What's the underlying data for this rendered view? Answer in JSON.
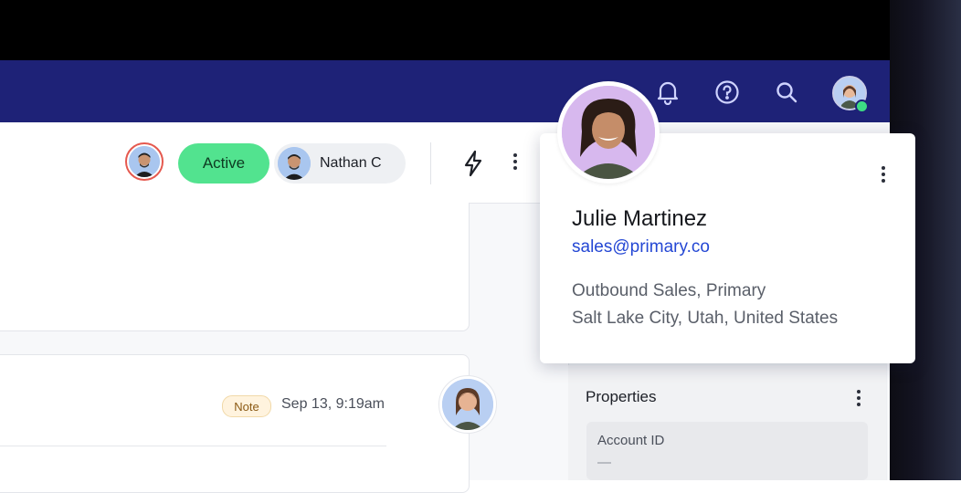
{
  "header": {
    "icons": [
      "bell-icon",
      "help-icon",
      "search-icon",
      "user-avatar"
    ]
  },
  "record": {
    "status_label": "Active",
    "owner_name": "Nathan C"
  },
  "timeline": {
    "note_badge": "Note",
    "note_time": "Sep 13, 9:19am"
  },
  "sidebar": {
    "properties_title": "Properties",
    "account_id_label": "Account ID",
    "account_id_value": "—"
  },
  "contact_popup": {
    "name": "Julie Martinez",
    "email": "sales@primary.co",
    "company": "Outbound Sales, Primary",
    "location": "Salt Lake City, Utah, United States"
  },
  "colors": {
    "navbar": "#1e2277",
    "active_status": "#52e38f",
    "email_link": "#2447d4",
    "online": "#3ddc84"
  }
}
